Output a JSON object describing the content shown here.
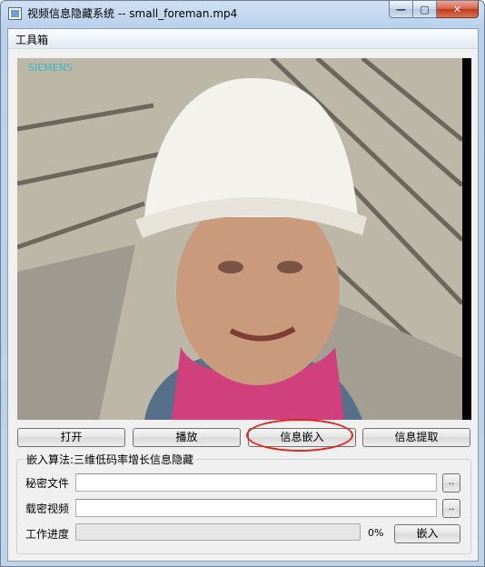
{
  "window": {
    "title": "视频信息隐藏系统 -- small_foreman.mp4",
    "min_glyph": "—",
    "max_glyph": "▢",
    "close_glyph": "✕"
  },
  "menu": {
    "toolbox": "工具箱"
  },
  "video": {
    "overlay_text": "SIEMENS"
  },
  "buttons": {
    "open": "打开",
    "play": "播放",
    "embed_info": "信息嵌入",
    "extract_info": "信息提取"
  },
  "group": {
    "title": "嵌入算法:三维低码率增长信息隐藏",
    "secret_file_label": "秘密文件",
    "secret_file_value": "",
    "carrier_video_label": "载密视频",
    "carrier_video_value": "",
    "browse_label": "..",
    "progress_label": "工作进度",
    "progress_text": "0%",
    "progress_fraction": 0,
    "embed_button": "嵌入"
  },
  "colors": {
    "annotation": "#e52420",
    "progress": "#06b025"
  }
}
